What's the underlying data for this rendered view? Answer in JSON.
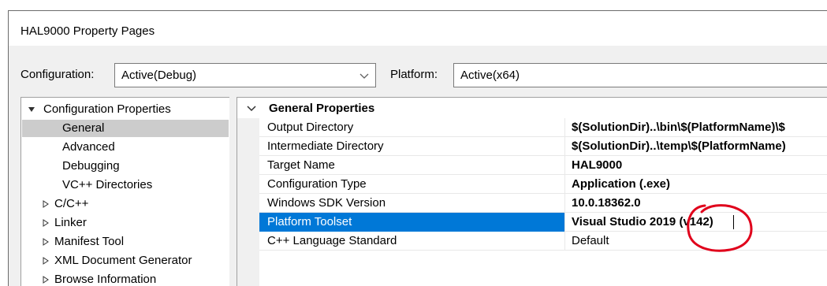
{
  "window": {
    "title": "HAL9000 Property Pages"
  },
  "toolbar": {
    "configuration_label": "Configuration:",
    "configuration_value": "Active(Debug)",
    "platform_label": "Platform:",
    "platform_value": "Active(x64)"
  },
  "tree": {
    "root_label": "Configuration Properties",
    "items": [
      {
        "label": "General",
        "selected": true
      },
      {
        "label": "Advanced"
      },
      {
        "label": "Debugging"
      },
      {
        "label": "VC++ Directories"
      },
      {
        "label": "C/C++",
        "expandable": true
      },
      {
        "label": "Linker",
        "expandable": true
      },
      {
        "label": "Manifest Tool",
        "expandable": true
      },
      {
        "label": "XML Document Generator",
        "expandable": true
      },
      {
        "label": "Browse Information",
        "expandable": true
      }
    ]
  },
  "grid": {
    "category": "General Properties",
    "rows": [
      {
        "name": "Output Directory",
        "value": "$(SolutionDir)..\\bin\\$(PlatformName)\\$"
      },
      {
        "name": "Intermediate Directory",
        "value": "$(SolutionDir)..\\temp\\$(PlatformName)"
      },
      {
        "name": "Target Name",
        "value": "HAL9000"
      },
      {
        "name": "Configuration Type",
        "value": "Application (.exe)"
      },
      {
        "name": "Windows SDK Version",
        "value": "10.0.18362.0"
      },
      {
        "name": "Platform Toolset",
        "value": "Visual Studio 2019 (v142)",
        "selected": true
      },
      {
        "name": "C++ Language Standard",
        "value": "Default",
        "bold": false
      }
    ]
  },
  "annotation": {
    "color": "#e0001b"
  },
  "colors": {
    "selection": "#0078d7",
    "tree_selection": "#cccccc",
    "chrome": "#f0f0f0"
  },
  "icons": {
    "root_expander": "collapse-triangle-icon",
    "child_expander": "expand-triangle-icon",
    "category": "chevron-down-icon",
    "combo": "chevron-down-icon"
  }
}
